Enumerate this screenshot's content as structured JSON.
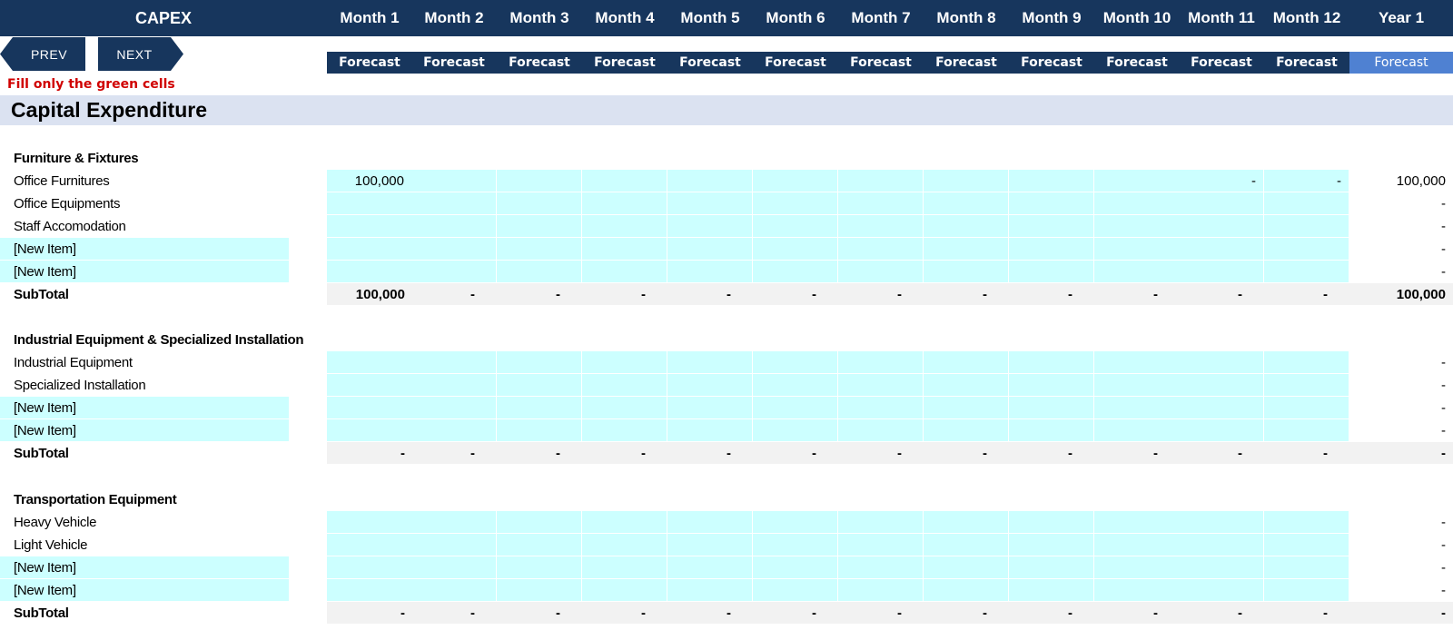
{
  "header": {
    "title": "CAPEX",
    "months": [
      "Month 1",
      "Month 2",
      "Month 3",
      "Month 4",
      "Month 5",
      "Month 6",
      "Month 7",
      "Month 8",
      "Month 9",
      "Month 10",
      "Month 11",
      "Month 12",
      "Year 1"
    ],
    "forecast": [
      "Forecast",
      "Forecast",
      "Forecast",
      "Forecast",
      "Forecast",
      "Forecast",
      "Forecast",
      "Forecast",
      "Forecast",
      "Forecast",
      "Forecast",
      "Forecast",
      "Forecast"
    ]
  },
  "nav": {
    "prev": "PREV",
    "next": "NEXT"
  },
  "instruction": "Fill only the green cells",
  "section_title": "Capital Expenditure",
  "groups": [
    {
      "title": "Furniture & Fixtures",
      "items": [
        {
          "label": "Office Furnitures",
          "values": [
            "100,000",
            "",
            "",
            "",
            "",
            "",
            "",
            "",
            "",
            "",
            "-",
            "-"
          ],
          "total": "100,000",
          "new": false
        },
        {
          "label": "Office  Equipments",
          "values": [
            "",
            "",
            "",
            "",
            "",
            "",
            "",
            "",
            "",
            "",
            "",
            ""
          ],
          "total": "-",
          "new": false
        },
        {
          "label": "Staff Accomodation",
          "values": [
            "",
            "",
            "",
            "",
            "",
            "",
            "",
            "",
            "",
            "",
            "",
            ""
          ],
          "total": "-",
          "new": false
        },
        {
          "label": "[New Item]",
          "values": [
            "",
            "",
            "",
            "",
            "",
            "",
            "",
            "",
            "",
            "",
            "",
            ""
          ],
          "total": "-",
          "new": true
        },
        {
          "label": "[New Item]",
          "values": [
            "",
            "",
            "",
            "",
            "",
            "",
            "",
            "",
            "",
            "",
            "",
            ""
          ],
          "total": "-",
          "new": true
        }
      ],
      "subtotal_label": "SubTotal",
      "subtotal": [
        "100,000",
        "-",
        "-",
        "-",
        "-",
        "-",
        "-",
        "-",
        "-",
        "-",
        "-",
        "-"
      ],
      "subtotal_total": "100,000"
    },
    {
      "title": "Industrial Equipment & Specialized Installation",
      "items": [
        {
          "label": "Industrial Equipment",
          "values": [
            "",
            "",
            "",
            "",
            "",
            "",
            "",
            "",
            "",
            "",
            "",
            ""
          ],
          "total": "-",
          "new": false
        },
        {
          "label": "Specialized Installation",
          "values": [
            "",
            "",
            "",
            "",
            "",
            "",
            "",
            "",
            "",
            "",
            "",
            ""
          ],
          "total": "-",
          "new": false
        },
        {
          "label": "[New Item]",
          "values": [
            "",
            "",
            "",
            "",
            "",
            "",
            "",
            "",
            "",
            "",
            "",
            ""
          ],
          "total": "-",
          "new": true
        },
        {
          "label": "[New Item]",
          "values": [
            "",
            "",
            "",
            "",
            "",
            "",
            "",
            "",
            "",
            "",
            "",
            ""
          ],
          "total": "-",
          "new": true
        }
      ],
      "subtotal_label": "SubTotal",
      "subtotal": [
        "-",
        "-",
        "-",
        "-",
        "-",
        "-",
        "-",
        "-",
        "-",
        "-",
        "-",
        "-"
      ],
      "subtotal_total": "-"
    },
    {
      "title": "Transportation Equipment",
      "items": [
        {
          "label": "Heavy Vehicle",
          "values": [
            "",
            "",
            "",
            "",
            "",
            "",
            "",
            "",
            "",
            "",
            "",
            ""
          ],
          "total": "-",
          "new": false
        },
        {
          "label": "Light Vehicle",
          "values": [
            "",
            "",
            "",
            "",
            "",
            "",
            "",
            "",
            "",
            "",
            "",
            ""
          ],
          "total": "-",
          "new": false
        },
        {
          "label": "[New Item]",
          "values": [
            "",
            "",
            "",
            "",
            "",
            "",
            "",
            "",
            "",
            "",
            "",
            ""
          ],
          "total": "-",
          "new": true
        },
        {
          "label": "[New Item]",
          "values": [
            "",
            "",
            "",
            "",
            "",
            "",
            "",
            "",
            "",
            "",
            "",
            ""
          ],
          "total": "-",
          "new": true
        }
      ],
      "subtotal_label": "SubTotal",
      "subtotal": [
        "-",
        "-",
        "-",
        "-",
        "-",
        "-",
        "-",
        "-",
        "-",
        "-",
        "-",
        "-"
      ],
      "subtotal_total": "-"
    }
  ],
  "colors": {
    "header_bg": "#17365d",
    "year_forecast_bg": "#4f81d2",
    "input_cell": "#ccffff",
    "subtotal_bg": "#f2f2f2",
    "section_band": "#dbe2f1",
    "instruction": "#d00000"
  }
}
